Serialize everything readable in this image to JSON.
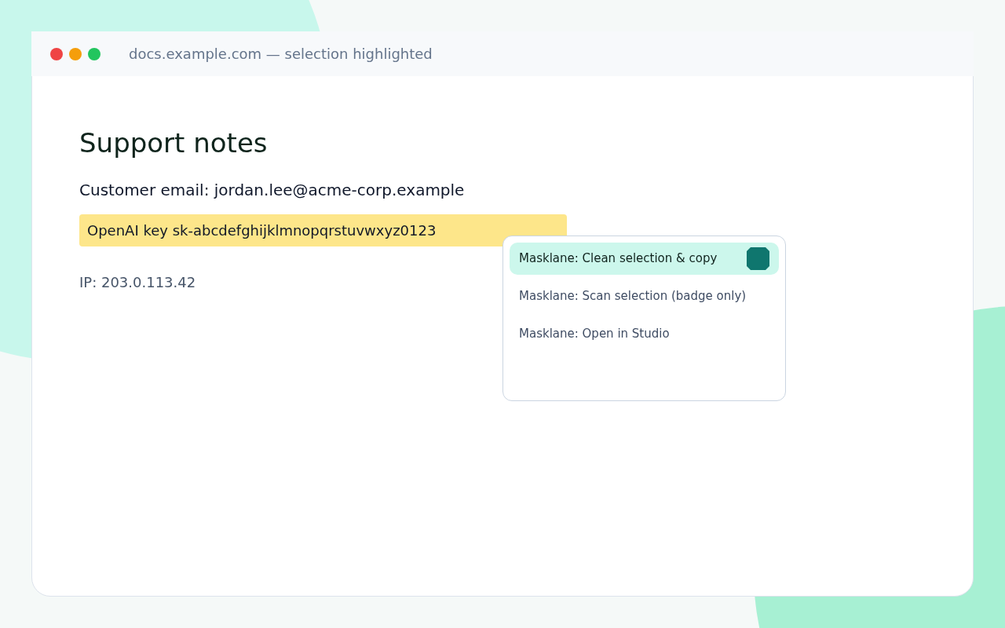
{
  "window": {
    "title": "docs.example.com — selection highlighted"
  },
  "document": {
    "heading": "Support notes",
    "email_line": "Customer email: jordan.lee@acme-corp.example",
    "selection": {
      "text": "OpenAI key sk-abcdefghijklmnopqrstuvwxyz0123",
      "highlighted": true
    },
    "ip_line": "IP: 203.0.113.42"
  },
  "context_menu": {
    "items": [
      {
        "label": "Masklane: Clean selection & copy",
        "selected": true
      },
      {
        "label": "Masklane: Scan selection (badge only)",
        "selected": false
      },
      {
        "label": "Masklane: Open in Studio",
        "selected": false
      }
    ]
  }
}
